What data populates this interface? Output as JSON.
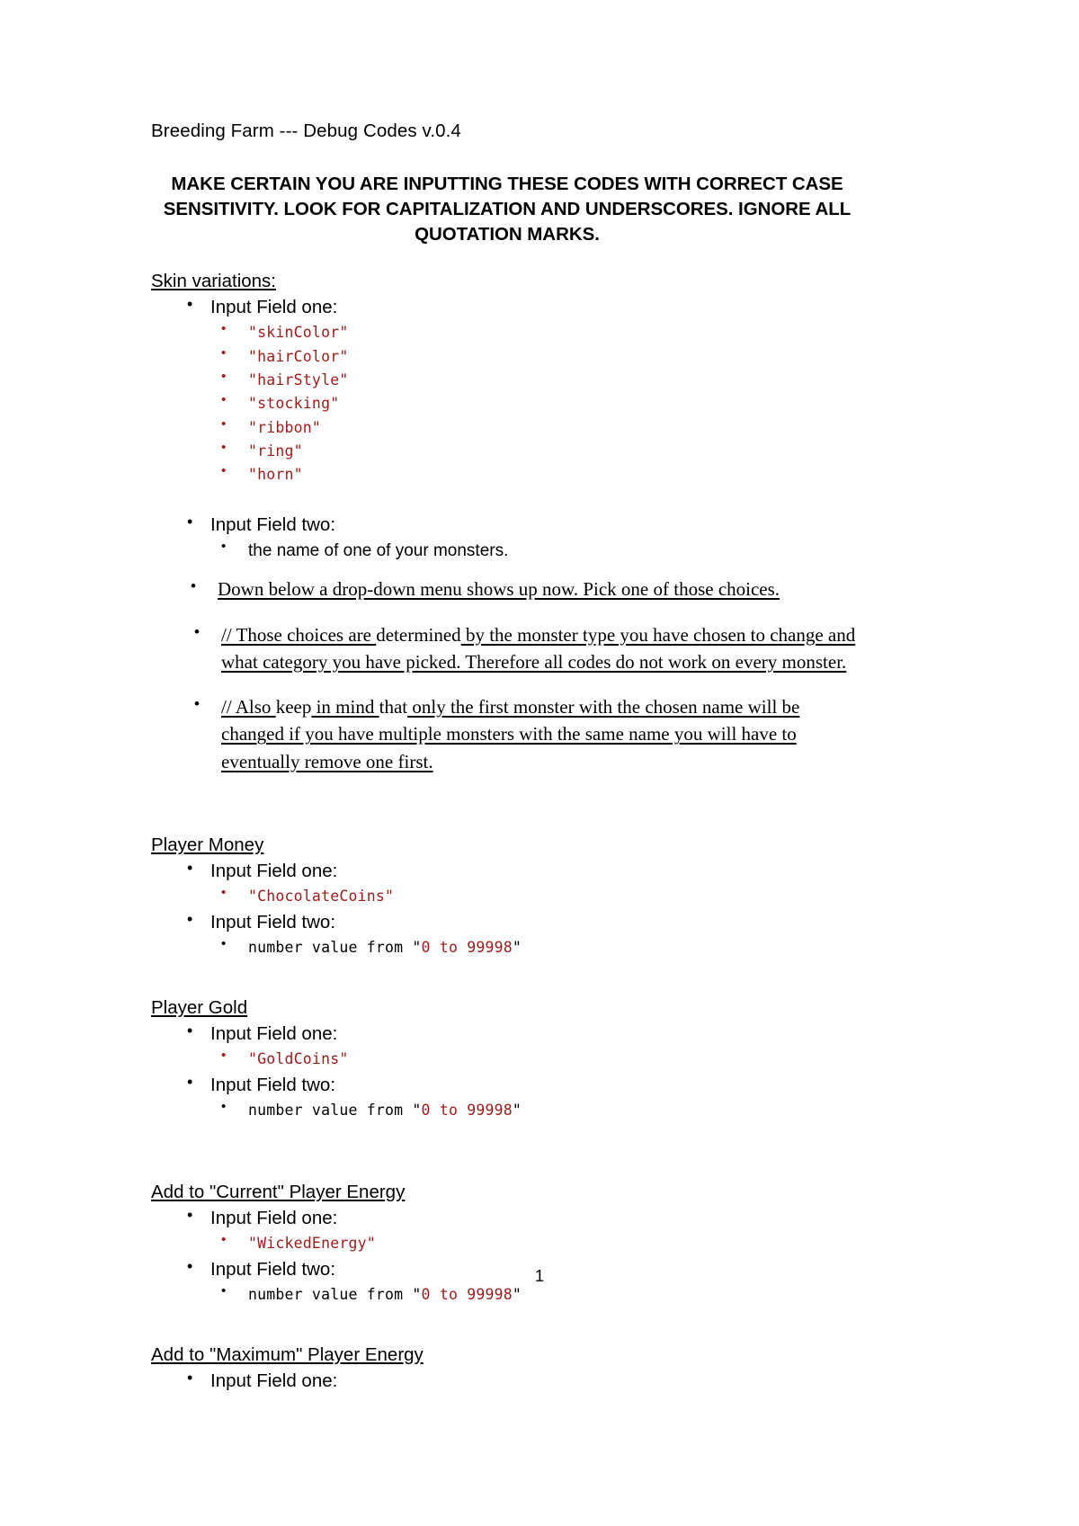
{
  "document": {
    "title": "Breeding Farm --- Debug Codes v.0.4",
    "notice": "MAKE CERTAIN YOU ARE INPUTTING THESE CODES WITH CORRECT CASE SENSITIVITY. LOOK FOR CAPITALIZATION AND UNDERSCORES. IGNORE ALL QUOTATION MARKS.",
    "page_number": "1",
    "code_color": "#9e1b1b",
    "text_color": "#000000",
    "background": "#ffffff"
  },
  "labels": {
    "input_field_one": "Input Field one:",
    "input_field_two": "Input Field two:",
    "number_value_prefix": "number value from \"",
    "number_value_range": "0 to 99998",
    "number_value_suffix": "\""
  },
  "sections": {
    "skin_variations": {
      "heading": "Skin variations:",
      "field_one_label": "Input Field one:",
      "codes": [
        "\"skinColor\"",
        "\"hairColor\"",
        "\"hairStyle\"",
        "\"stocking\"",
        "\"ribbon\"",
        "\"ring\"",
        "\"horn\""
      ],
      "field_two_label": "Input Field two:",
      "field_two_value": "the name of one of your monsters.",
      "dropdown_note": "Down below a drop-down menu shows up now. Pick one of those choices.",
      "note_one": {
        "part1": "// Those choices are ",
        "part2": "determined",
        "part3": " by the monster type you have chosen to change and what category you have picked. Therefore all codes do not work on every monster."
      },
      "note_two": {
        "part1": "// Also ",
        "part2": "keep",
        "part3": " in mind ",
        "part4": "that",
        "part5": " only the first monster with the chosen name will be changed if you have multiple monsters with the same name you will have to eventually remove one first."
      }
    },
    "player_money": {
      "heading": "Player Money",
      "field_one_label": "Input Field one:",
      "field_one_code": "\"ChocolateCoins\"",
      "field_two_label": "Input Field two:",
      "field_two_prefix": "number value from \"",
      "field_two_range": "0 to 99998",
      "field_two_suffix": "\""
    },
    "player_gold": {
      "heading": "Player Gold",
      "field_one_label": "Input Field one:",
      "field_one_code": "\"GoldCoins\"",
      "field_two_label": "Input Field two:",
      "field_two_prefix": "number value from \"",
      "field_two_range": "0 to 99998",
      "field_two_suffix": "\""
    },
    "current_player_energy": {
      "heading": "Add to \"Current\" Player Energy",
      "field_one_label": "Input Field one:",
      "field_one_code": "\"WickedEnergy\"",
      "field_two_label": "Input Field two:",
      "field_two_prefix": "number value from \"",
      "field_two_range": "0 to 99998",
      "field_two_suffix": "\""
    },
    "maximum_player_energy": {
      "heading": "Add to \"Maximum\" Player Energy",
      "field_one_label": "Input Field one:"
    }
  }
}
